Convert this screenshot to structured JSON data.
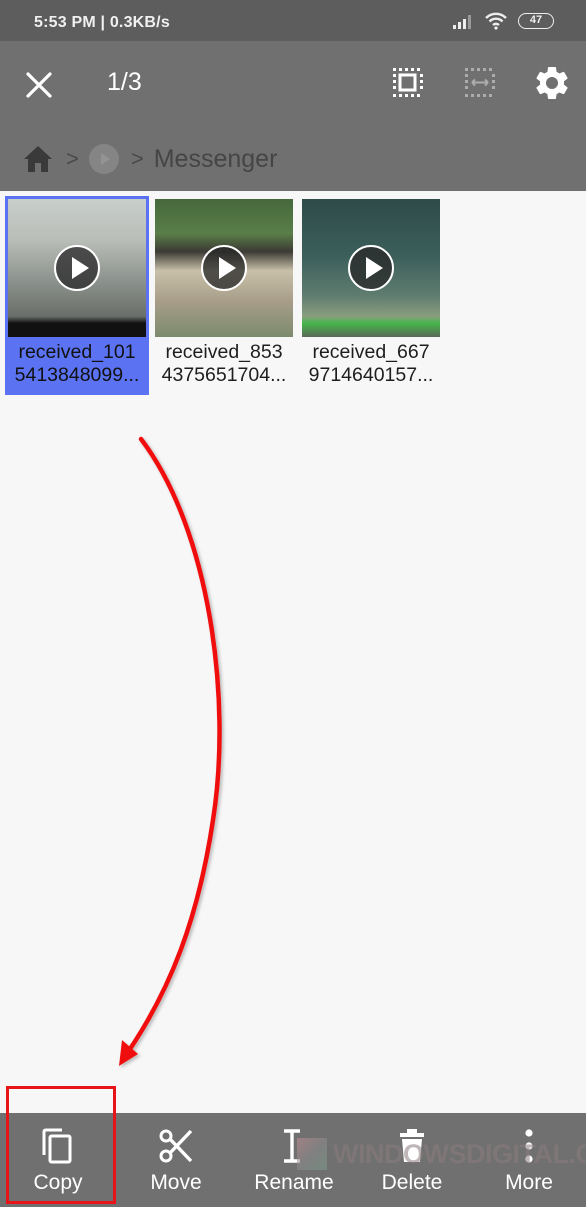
{
  "status_bar": {
    "time_speed": "5:53 PM | 0.3KB/s",
    "battery": "47",
    "icons": [
      "signal-icon",
      "wifi-icon",
      "battery-icon"
    ]
  },
  "app_bar": {
    "close_icon": "close-icon",
    "selection_count": "1/3",
    "actions": [
      "select-all-icon",
      "select-range-icon",
      "settings-icon"
    ]
  },
  "breadcrumb": {
    "items": [
      {
        "icon": "home-icon"
      },
      {
        "icon": "media-icon"
      },
      {
        "label": "Messenger"
      }
    ],
    "separator": ">"
  },
  "files": [
    {
      "name_line1": "received_101",
      "name_line2": "5413848099...",
      "type": "video",
      "selected": true
    },
    {
      "name_line1": "received_853",
      "name_line2": "4375651704...",
      "type": "video",
      "selected": false
    },
    {
      "name_line1": "received_667",
      "name_line2": "9714640157...",
      "type": "video",
      "selected": false
    }
  ],
  "bottom_actions": [
    {
      "label": "Copy",
      "icon": "copy-icon"
    },
    {
      "label": "Move",
      "icon": "scissors-icon"
    },
    {
      "label": "Rename",
      "icon": "text-cursor-icon"
    },
    {
      "label": "Delete",
      "icon": "trash-icon"
    },
    {
      "label": "More",
      "icon": "more-vertical-icon"
    }
  ],
  "watermark": "WINDOWSDIGITAL.COM",
  "annotation": {
    "highlight_target": "Copy",
    "color": "#e8141a"
  },
  "colors": {
    "selected": "#5b73f2",
    "bar": "#707070",
    "status": "#5d5d5d"
  }
}
